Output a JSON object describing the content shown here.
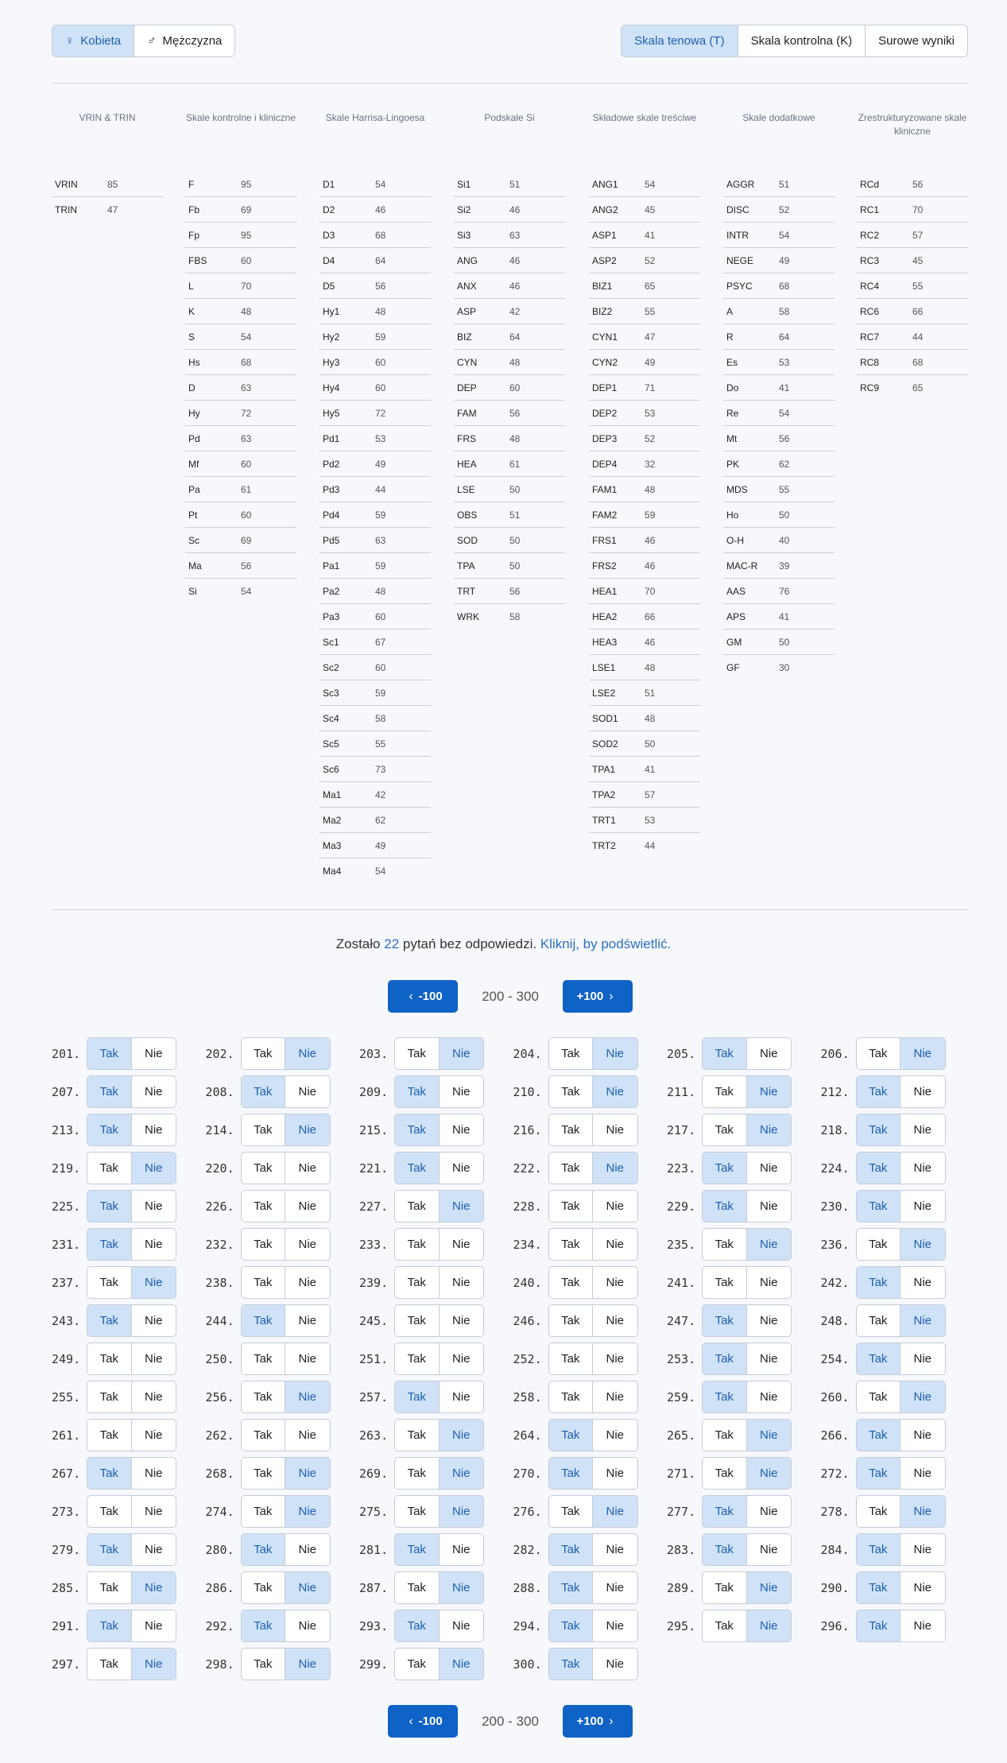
{
  "gender": {
    "options": [
      {
        "label": "Kobieta",
        "icon": "female-icon",
        "glyph": "♀",
        "active": true
      },
      {
        "label": "Mężczyzna",
        "icon": "male-icon",
        "glyph": "♂",
        "active": false
      }
    ]
  },
  "scale_type": {
    "options": [
      {
        "label": "Skala tenowa (T)",
        "active": true
      },
      {
        "label": "Skala kontrolna (K)",
        "active": false
      },
      {
        "label": "Surowe wyniki",
        "active": false
      }
    ]
  },
  "scale_groups": [
    {
      "title": "VRIN & TRIN",
      "rows": [
        [
          "VRIN",
          "85"
        ],
        [
          "TRIN",
          "47"
        ]
      ]
    },
    {
      "title": "Skale kontrolne i kliniczne",
      "rows": [
        [
          "F",
          "95"
        ],
        [
          "Fb",
          "69"
        ],
        [
          "Fp",
          "95"
        ],
        [
          "FBS",
          "60"
        ],
        [
          "L",
          "70"
        ],
        [
          "K",
          "48"
        ],
        [
          "S",
          "54"
        ],
        [
          "Hs",
          "68"
        ],
        [
          "D",
          "63"
        ],
        [
          "Hy",
          "72"
        ],
        [
          "Pd",
          "63"
        ],
        [
          "Mf",
          "60"
        ],
        [
          "Pa",
          "61"
        ],
        [
          "Pt",
          "60"
        ],
        [
          "Sc",
          "69"
        ],
        [
          "Ma",
          "56"
        ],
        [
          "Si",
          "54"
        ]
      ]
    },
    {
      "title": "Skale Harrisa-Lingoesa",
      "rows": [
        [
          "D1",
          "54"
        ],
        [
          "D2",
          "46"
        ],
        [
          "D3",
          "68"
        ],
        [
          "D4",
          "64"
        ],
        [
          "D5",
          "56"
        ],
        [
          "Hy1",
          "48"
        ],
        [
          "Hy2",
          "59"
        ],
        [
          "Hy3",
          "60"
        ],
        [
          "Hy4",
          "60"
        ],
        [
          "Hy5",
          "72"
        ],
        [
          "Pd1",
          "53"
        ],
        [
          "Pd2",
          "49"
        ],
        [
          "Pd3",
          "44"
        ],
        [
          "Pd4",
          "59"
        ],
        [
          "Pd5",
          "63"
        ],
        [
          "Pa1",
          "59"
        ],
        [
          "Pa2",
          "48"
        ],
        [
          "Pa3",
          "60"
        ],
        [
          "Sc1",
          "67"
        ],
        [
          "Sc2",
          "60"
        ],
        [
          "Sc3",
          "59"
        ],
        [
          "Sc4",
          "58"
        ],
        [
          "Sc5",
          "55"
        ],
        [
          "Sc6",
          "73"
        ],
        [
          "Ma1",
          "42"
        ],
        [
          "Ma2",
          "62"
        ],
        [
          "Ma3",
          "49"
        ],
        [
          "Ma4",
          "54"
        ]
      ]
    },
    {
      "title": "Podskale Si",
      "rows": [
        [
          "Si1",
          "51"
        ],
        [
          "Si2",
          "46"
        ],
        [
          "Si3",
          "63"
        ],
        [
          "ANG",
          "46"
        ],
        [
          "ANX",
          "46"
        ],
        [
          "ASP",
          "42"
        ],
        [
          "BIZ",
          "64"
        ],
        [
          "CYN",
          "48"
        ],
        [
          "DEP",
          "60"
        ],
        [
          "FAM",
          "56"
        ],
        [
          "FRS",
          "48"
        ],
        [
          "HEA",
          "61"
        ],
        [
          "LSE",
          "50"
        ],
        [
          "OBS",
          "51"
        ],
        [
          "SOD",
          "50"
        ],
        [
          "TPA",
          "50"
        ],
        [
          "TRT",
          "56"
        ],
        [
          "WRK",
          "58"
        ]
      ]
    },
    {
      "title": "Składowe skale treściwe",
      "rows": [
        [
          "ANG1",
          "54"
        ],
        [
          "ANG2",
          "45"
        ],
        [
          "ASP1",
          "41"
        ],
        [
          "ASP2",
          "52"
        ],
        [
          "BIZ1",
          "65"
        ],
        [
          "BIZ2",
          "55"
        ],
        [
          "CYN1",
          "47"
        ],
        [
          "CYN2",
          "49"
        ],
        [
          "DEP1",
          "71"
        ],
        [
          "DEP2",
          "53"
        ],
        [
          "DEP3",
          "52"
        ],
        [
          "DEP4",
          "32"
        ],
        [
          "FAM1",
          "48"
        ],
        [
          "FAM2",
          "59"
        ],
        [
          "FRS1",
          "46"
        ],
        [
          "FRS2",
          "46"
        ],
        [
          "HEA1",
          "70"
        ],
        [
          "HEA2",
          "66"
        ],
        [
          "HEA3",
          "46"
        ],
        [
          "LSE1",
          "48"
        ],
        [
          "LSE2",
          "51"
        ],
        [
          "SOD1",
          "48"
        ],
        [
          "SOD2",
          "50"
        ],
        [
          "TPA1",
          "41"
        ],
        [
          "TPA2",
          "57"
        ],
        [
          "TRT1",
          "53"
        ],
        [
          "TRT2",
          "44"
        ]
      ]
    },
    {
      "title": "Skale dodatkowe",
      "rows": [
        [
          "AGGR",
          "51"
        ],
        [
          "DISC",
          "52"
        ],
        [
          "INTR",
          "54"
        ],
        [
          "NEGE",
          "49"
        ],
        [
          "PSYC",
          "68"
        ],
        [
          "A",
          "58"
        ],
        [
          "R",
          "64"
        ],
        [
          "Es",
          "53"
        ],
        [
          "Do",
          "41"
        ],
        [
          "Re",
          "54"
        ],
        [
          "Mt",
          "56"
        ],
        [
          "PK",
          "62"
        ],
        [
          "MDS",
          "55"
        ],
        [
          "Ho",
          "50"
        ],
        [
          "O-H",
          "40"
        ],
        [
          "MAC-R",
          "39"
        ],
        [
          "AAS",
          "76"
        ],
        [
          "APS",
          "41"
        ],
        [
          "GM",
          "50"
        ],
        [
          "GF",
          "30"
        ]
      ]
    },
    {
      "title": "Zrestrukturyzowane skale kliniczne",
      "rows": [
        [
          "RCd",
          "56"
        ],
        [
          "RC1",
          "70"
        ],
        [
          "RC2",
          "57"
        ],
        [
          "RC3",
          "45"
        ],
        [
          "RC4",
          "55"
        ],
        [
          "RC6",
          "66"
        ],
        [
          "RC7",
          "44"
        ],
        [
          "RC8",
          "68"
        ],
        [
          "RC9",
          "65"
        ]
      ]
    }
  ],
  "notice": {
    "before": "Zostało ",
    "count": "22",
    "after": " pytań bez odpowiedzi. ",
    "link": "Kliknij, by podświetlić."
  },
  "pager": {
    "prev_label": "-100",
    "next_label": "+100",
    "range": "200 - 300"
  },
  "answer_labels": {
    "yes": "Tak",
    "no": "Nie"
  },
  "questions": [
    [
      "201.",
      "T"
    ],
    [
      "202.",
      "N"
    ],
    [
      "203.",
      "N"
    ],
    [
      "204.",
      "N"
    ],
    [
      "205.",
      "T"
    ],
    [
      "206.",
      "N"
    ],
    [
      "207.",
      "T"
    ],
    [
      "208.",
      "T"
    ],
    [
      "209.",
      "T"
    ],
    [
      "210.",
      "N"
    ],
    [
      "211.",
      "N"
    ],
    [
      "212.",
      "T"
    ],
    [
      "213.",
      "T"
    ],
    [
      "214.",
      "N"
    ],
    [
      "215.",
      "T"
    ],
    [
      "216.",
      "-"
    ],
    [
      "217.",
      "N"
    ],
    [
      "218.",
      "T"
    ],
    [
      "219.",
      "N"
    ],
    [
      "220.",
      "-"
    ],
    [
      "221.",
      "T"
    ],
    [
      "222.",
      "N"
    ],
    [
      "223.",
      "T"
    ],
    [
      "224.",
      "T"
    ],
    [
      "225.",
      "T"
    ],
    [
      "226.",
      "-"
    ],
    [
      "227.",
      "N"
    ],
    [
      "228.",
      "-"
    ],
    [
      "229.",
      "T"
    ],
    [
      "230.",
      "T"
    ],
    [
      "231.",
      "T"
    ],
    [
      "232.",
      "-"
    ],
    [
      "233.",
      "-"
    ],
    [
      "234.",
      "-"
    ],
    [
      "235.",
      "N"
    ],
    [
      "236.",
      "N"
    ],
    [
      "237.",
      "N"
    ],
    [
      "238.",
      "-"
    ],
    [
      "239.",
      "-"
    ],
    [
      "240.",
      "-"
    ],
    [
      "241.",
      "-"
    ],
    [
      "242.",
      "T"
    ],
    [
      "243.",
      "T"
    ],
    [
      "244.",
      "T"
    ],
    [
      "245.",
      "-"
    ],
    [
      "246.",
      "-"
    ],
    [
      "247.",
      "T"
    ],
    [
      "248.",
      "N"
    ],
    [
      "249.",
      "-"
    ],
    [
      "250.",
      "-"
    ],
    [
      "251.",
      "-"
    ],
    [
      "252.",
      "-"
    ],
    [
      "253.",
      "T"
    ],
    [
      "254.",
      "T"
    ],
    [
      "255.",
      "-"
    ],
    [
      "256.",
      "N"
    ],
    [
      "257.",
      "T"
    ],
    [
      "258.",
      "-"
    ],
    [
      "259.",
      "T"
    ],
    [
      "260.",
      "N"
    ],
    [
      "261.",
      "-"
    ],
    [
      "262.",
      "-"
    ],
    [
      "263.",
      "N"
    ],
    [
      "264.",
      "T"
    ],
    [
      "265.",
      "N"
    ],
    [
      "266.",
      "T"
    ],
    [
      "267.",
      "T"
    ],
    [
      "268.",
      "N"
    ],
    [
      "269.",
      "N"
    ],
    [
      "270.",
      "T"
    ],
    [
      "271.",
      "N"
    ],
    [
      "272.",
      "T"
    ],
    [
      "273.",
      "-"
    ],
    [
      "274.",
      "N"
    ],
    [
      "275.",
      "N"
    ],
    [
      "276.",
      "N"
    ],
    [
      "277.",
      "T"
    ],
    [
      "278.",
      "N"
    ],
    [
      "279.",
      "T"
    ],
    [
      "280.",
      "T"
    ],
    [
      "281.",
      "T"
    ],
    [
      "282.",
      "T"
    ],
    [
      "283.",
      "T"
    ],
    [
      "284.",
      "T"
    ],
    [
      "285.",
      "N"
    ],
    [
      "286.",
      "N"
    ],
    [
      "287.",
      "N"
    ],
    [
      "288.",
      "T"
    ],
    [
      "289.",
      "N"
    ],
    [
      "290.",
      "T"
    ],
    [
      "291.",
      "T"
    ],
    [
      "292.",
      "T"
    ],
    [
      "293.",
      "T"
    ],
    [
      "294.",
      "T"
    ],
    [
      "295.",
      "N"
    ],
    [
      "296.",
      "T"
    ],
    [
      "297.",
      "N"
    ],
    [
      "298.",
      "N"
    ],
    [
      "299.",
      "N"
    ],
    [
      "300.",
      "T"
    ]
  ]
}
